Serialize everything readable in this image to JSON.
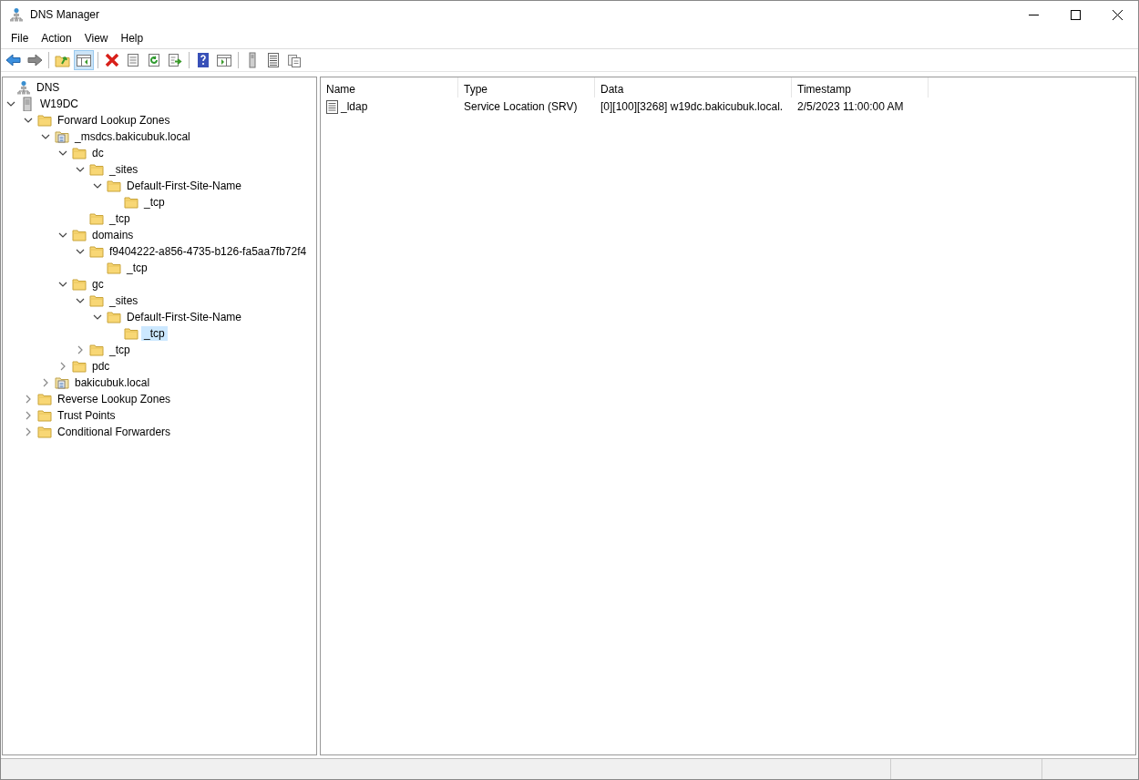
{
  "window": {
    "title": "DNS Manager"
  },
  "menu": [
    "File",
    "Action",
    "View",
    "Help"
  ],
  "toolbar": [
    {
      "kind": "back",
      "pressed": false
    },
    {
      "kind": "forward",
      "pressed": false
    },
    {
      "kind": "sep"
    },
    {
      "kind": "up",
      "pressed": false
    },
    {
      "kind": "tree",
      "pressed": true
    },
    {
      "kind": "sep"
    },
    {
      "kind": "delete",
      "pressed": false
    },
    {
      "kind": "properties",
      "pressed": false
    },
    {
      "kind": "refresh",
      "pressed": false
    },
    {
      "kind": "export",
      "pressed": false
    },
    {
      "kind": "sep"
    },
    {
      "kind": "help",
      "pressed": false
    },
    {
      "kind": "pane",
      "pressed": false
    },
    {
      "kind": "sep"
    },
    {
      "kind": "server",
      "pressed": false
    },
    {
      "kind": "list",
      "pressed": false
    },
    {
      "kind": "copy",
      "pressed": false
    }
  ],
  "tree": [
    {
      "label": "DNS",
      "kind": "dns",
      "selected": false,
      "children": [
        {
          "label": "W19DC",
          "kind": "server",
          "expanded": true,
          "selected": false,
          "children": [
            {
              "label": "Forward Lookup Zones",
              "kind": "folder",
              "expanded": true,
              "selected": false,
              "children": [
                {
                  "label": "_msdcs.bakicubuk.local",
                  "kind": "zone",
                  "expanded": true,
                  "selected": false,
                  "children": [
                    {
                      "label": "dc",
                      "kind": "folder",
                      "expanded": true,
                      "selected": false,
                      "children": [
                        {
                          "label": "_sites",
                          "kind": "folder",
                          "expanded": true,
                          "selected": false,
                          "children": [
                            {
                              "label": "Default-First-Site-Name",
                              "kind": "folder",
                              "expanded": true,
                              "selected": false,
                              "children": [
                                {
                                  "label": "_tcp",
                                  "kind": "folder",
                                  "selected": false
                                }
                              ]
                            }
                          ]
                        },
                        {
                          "label": "_tcp",
                          "kind": "folder",
                          "selected": false
                        }
                      ]
                    },
                    {
                      "label": "domains",
                      "kind": "folder",
                      "expanded": true,
                      "selected": false,
                      "children": [
                        {
                          "label": "f9404222-a856-4735-b126-fa5aa7fb72f4",
                          "kind": "folder",
                          "expanded": true,
                          "selected": false,
                          "children": [
                            {
                              "label": "_tcp",
                              "kind": "folder",
                              "selected": false
                            }
                          ]
                        }
                      ]
                    },
                    {
                      "label": "gc",
                      "kind": "folder",
                      "expanded": true,
                      "selected": false,
                      "children": [
                        {
                          "label": "_sites",
                          "kind": "folder",
                          "expanded": true,
                          "selected": false,
                          "children": [
                            {
                              "label": "Default-First-Site-Name",
                              "kind": "folder",
                              "expanded": true,
                              "selected": false,
                              "children": [
                                {
                                  "label": "_tcp",
                                  "kind": "folder",
                                  "selected": true
                                }
                              ]
                            }
                          ]
                        },
                        {
                          "label": "_tcp",
                          "kind": "folder",
                          "expanded": false,
                          "selected": false
                        }
                      ]
                    },
                    {
                      "label": "pdc",
                      "kind": "folder",
                      "expanded": false,
                      "selected": false
                    }
                  ]
                },
                {
                  "label": "bakicubuk.local",
                  "kind": "zone",
                  "expanded": false,
                  "selected": false
                }
              ]
            },
            {
              "label": "Reverse Lookup Zones",
              "kind": "folder",
              "expanded": false,
              "selected": false
            },
            {
              "label": "Trust Points",
              "kind": "folder",
              "expanded": false,
              "selected": false
            },
            {
              "label": "Conditional Forwarders",
              "kind": "folder",
              "expanded": false,
              "selected": false
            }
          ]
        }
      ]
    }
  ],
  "table": {
    "columns": [
      "Name",
      "Type",
      "Data",
      "Timestamp"
    ],
    "rows": [
      {
        "cells": [
          "_ldap",
          "Service Location (SRV)",
          "[0][100][3268] w19dc.bakicubuk.local.",
          "2/5/2023 11:00:00 AM"
        ],
        "selected": false
      }
    ]
  }
}
